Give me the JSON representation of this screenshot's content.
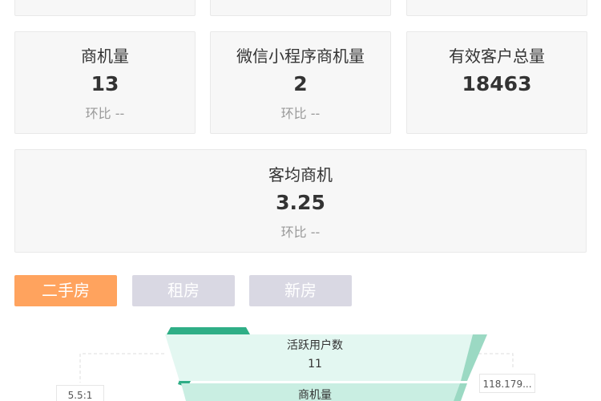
{
  "metrics_row2": [
    {
      "label": "商机量",
      "value": "13",
      "ratio": "环比 --"
    },
    {
      "label": "微信小程序商机量",
      "value": "2",
      "ratio": "环比 --"
    },
    {
      "label": "有效客户总量",
      "value": "18463",
      "ratio": ""
    }
  ],
  "metric_wide": {
    "label": "客均商机",
    "value": "3.25",
    "ratio": "环比 --"
  },
  "tabs": [
    {
      "label": "二手房",
      "active": true
    },
    {
      "label": "租房",
      "active": false
    },
    {
      "label": "新房",
      "active": false
    }
  ],
  "colors": {
    "active_tab": "#ffa35e",
    "inactive_tab": "#d9d8e3",
    "funnel_fill": "#e3f7f1",
    "funnel_edge": "#9bd9c3",
    "funnel_top": "#2fae86"
  },
  "funnel": {
    "stages": [
      {
        "label": "活跃用户数",
        "value": "11"
      },
      {
        "label": "商机量",
        "value": ""
      }
    ],
    "left_ratio": "5.5:1",
    "right_ratio": "118.179..."
  }
}
